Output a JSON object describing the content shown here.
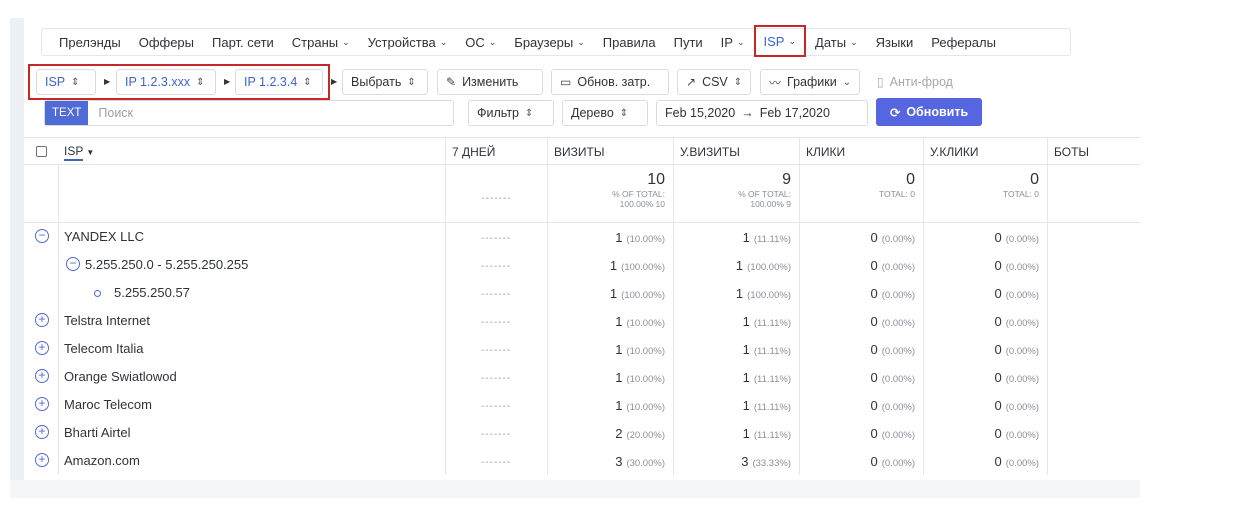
{
  "tabs": [
    {
      "label": "Прелэнды",
      "chev": false
    },
    {
      "label": "Офферы",
      "chev": false
    },
    {
      "label": "Парт. сети",
      "chev": false
    },
    {
      "label": "Страны",
      "chev": true
    },
    {
      "label": "Устройства",
      "chev": true
    },
    {
      "label": "ОС",
      "chev": true
    },
    {
      "label": "Браузеры",
      "chev": true
    },
    {
      "label": "Правила",
      "chev": false
    },
    {
      "label": "Пути",
      "chev": false
    },
    {
      "label": "IP",
      "chev": true
    },
    {
      "label": "ISP",
      "chev": true,
      "active": true
    },
    {
      "label": "Даты",
      "chev": true
    },
    {
      "label": "Языки",
      "chev": false
    },
    {
      "label": "Рефералы",
      "chev": false
    }
  ],
  "grouping": {
    "level1": "ISP",
    "level2": "IP 1.2.3.xxx",
    "level3": "IP 1.2.3.4",
    "select": "Выбрать"
  },
  "toolbar": {
    "edit": "Изменить",
    "update_costs": "Обнов. затр.",
    "csv": "CSV",
    "charts": "Графики",
    "antifraud": "Анти-фрод"
  },
  "search": {
    "badge": "TEXT",
    "placeholder": "Поиск",
    "filter": "Фильтр",
    "tree": "Дерево",
    "date_from": "Feb 15,2020",
    "date_arrow": "→",
    "date_to": "Feb 17,2020",
    "refresh": "Обновить"
  },
  "columns": {
    "isp": "ISP",
    "days7": "7 ДНЕЙ",
    "visits": "ВИЗИТЫ",
    "uvisits": "У.ВИЗИТЫ",
    "clicks": "КЛИКИ",
    "uclicks": "У.КЛИКИ",
    "bots": "БОТЫ"
  },
  "totals": {
    "sparkline": "-------",
    "visits": "10",
    "visits_sub1": "% OF TOTAL:",
    "visits_sub2": "100.00% 10",
    "uvisits": "9",
    "uvisits_sub1": "% OF TOTAL:",
    "uvisits_sub2": "100.00% 9",
    "clicks": "0",
    "clicks_sub": "TOTAL: 0",
    "uclicks": "0",
    "uclicks_sub": "TOTAL: 0"
  },
  "rows": [
    {
      "name": "YANDEX LLC",
      "icon": "minus",
      "indent": 0,
      "spark": "-------",
      "visits": "1",
      "visits_pct": "(10.00%)",
      "uvisits": "1",
      "uvisits_pct": "(11.11%)",
      "clicks": "0",
      "clicks_pct": "(0.00%)",
      "uclicks": "0",
      "uclicks_pct": "(0.00%)"
    },
    {
      "name": "5.255.250.0 - 5.255.250.255",
      "icon": "minus",
      "indent": 1,
      "spark": "-------",
      "visits": "1",
      "visits_pct": "(100.00%)",
      "uvisits": "1",
      "uvisits_pct": "(100.00%)",
      "clicks": "0",
      "clicks_pct": "(0.00%)",
      "uclicks": "0",
      "uclicks_pct": "(0.00%)"
    },
    {
      "name": "5.255.250.57",
      "icon": "dot",
      "indent": 2,
      "spark": "-------",
      "visits": "1",
      "visits_pct": "(100.00%)",
      "uvisits": "1",
      "uvisits_pct": "(100.00%)",
      "clicks": "0",
      "clicks_pct": "(0.00%)",
      "uclicks": "0",
      "uclicks_pct": "(0.00%)"
    },
    {
      "name": "Telstra Internet",
      "icon": "plus",
      "indent": 0,
      "spark": "-------",
      "visits": "1",
      "visits_pct": "(10.00%)",
      "uvisits": "1",
      "uvisits_pct": "(11.11%)",
      "clicks": "0",
      "clicks_pct": "(0.00%)",
      "uclicks": "0",
      "uclicks_pct": "(0.00%)"
    },
    {
      "name": "Telecom Italia",
      "icon": "plus",
      "indent": 0,
      "spark": "-------",
      "visits": "1",
      "visits_pct": "(10.00%)",
      "uvisits": "1",
      "uvisits_pct": "(11.11%)",
      "clicks": "0",
      "clicks_pct": "(0.00%)",
      "uclicks": "0",
      "uclicks_pct": "(0.00%)"
    },
    {
      "name": "Orange Swiatlowod",
      "icon": "plus",
      "indent": 0,
      "spark": "-------",
      "visits": "1",
      "visits_pct": "(10.00%)",
      "uvisits": "1",
      "uvisits_pct": "(11.11%)",
      "clicks": "0",
      "clicks_pct": "(0.00%)",
      "uclicks": "0",
      "uclicks_pct": "(0.00%)"
    },
    {
      "name": "Maroc Telecom",
      "icon": "plus",
      "indent": 0,
      "spark": "-------",
      "visits": "1",
      "visits_pct": "(10.00%)",
      "uvisits": "1",
      "uvisits_pct": "(11.11%)",
      "clicks": "0",
      "clicks_pct": "(0.00%)",
      "uclicks": "0",
      "uclicks_pct": "(0.00%)"
    },
    {
      "name": "Bharti Airtel",
      "icon": "plus",
      "indent": 0,
      "spark": "-------",
      "visits": "2",
      "visits_pct": "(20.00%)",
      "uvisits": "1",
      "uvisits_pct": "(11.11%)",
      "clicks": "0",
      "clicks_pct": "(0.00%)",
      "uclicks": "0",
      "uclicks_pct": "(0.00%)"
    },
    {
      "name": "Amazon.com",
      "icon": "plus",
      "indent": 0,
      "spark": "-------",
      "visits": "3",
      "visits_pct": "(30.00%)",
      "uvisits": "3",
      "uvisits_pct": "(33.33%)",
      "clicks": "0",
      "clicks_pct": "(0.00%)",
      "uclicks": "0",
      "uclicks_pct": "(0.00%)"
    }
  ]
}
